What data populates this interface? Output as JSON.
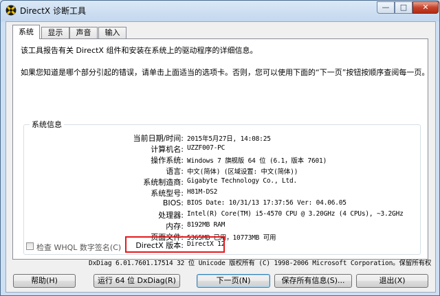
{
  "window": {
    "title": "DirectX 诊断工具",
    "icon": "directx-icon"
  },
  "caption": {
    "minimize": "—",
    "maximize": "□",
    "close": "✕"
  },
  "tabs": [
    {
      "label": "系统",
      "active": true
    },
    {
      "label": "显示",
      "active": false
    },
    {
      "label": "声音",
      "active": false
    },
    {
      "label": "输入",
      "active": false
    }
  ],
  "intro": {
    "line1": "该工具报告有关 DirectX 组件和安装在系统上的驱动程序的详细信息。",
    "line2": "如果您知道是哪个部分引起的错误，请单击上面适当的选项卡。否则，您可以使用下面的“下一页”按钮按顺序查阅每一页。"
  },
  "system_info": {
    "title": "系统信息",
    "rows": [
      {
        "label": "当前日期/时间:",
        "value": "2015年5月27日, 14:08:25"
      },
      {
        "label": "计算机名:",
        "value": "UZZF007-PC"
      },
      {
        "label": "操作系统:",
        "value": "Windows 7 旗舰版 64 位 (6.1，版本 7601)"
      },
      {
        "label": "语言:",
        "value": "中文(简体) (区域设置: 中文(简体))"
      },
      {
        "label": "系统制造商:",
        "value": "Gigabyte Technology Co., Ltd."
      },
      {
        "label": "系统型号:",
        "value": "H81M-DS2"
      },
      {
        "label": "BIOS:",
        "value": "BIOS Date: 10/31/13 17:37:56 Ver: 04.06.05"
      },
      {
        "label": "处理器:",
        "value": "Intel(R) Core(TM) i5-4570 CPU @ 3.20GHz (4 CPUs), ~3.2GHz"
      },
      {
        "label": "内存:",
        "value": "8192MB RAM"
      },
      {
        "label": "页面文件:",
        "value": "5365MB 已用，10773MB 可用"
      },
      {
        "label": "DirectX 版本:",
        "value": "DirectX 12"
      }
    ],
    "highlight_color": "#e3191c"
  },
  "whql_checkbox": {
    "label": "检查 WHQL 数字签名(C)",
    "checked": false
  },
  "copyright": "DxDiag 6.01.7601.17514 32 位 Unicode 版权所有 (C) 1998-2006 Microsoft Corporation。保留所有权",
  "buttons": {
    "help": "帮助(H)",
    "run64": "运行 64 位 DxDiag(R)",
    "next": "下一页(N)",
    "save": "保存所有信息(S)...",
    "exit": "退出(X)"
  }
}
